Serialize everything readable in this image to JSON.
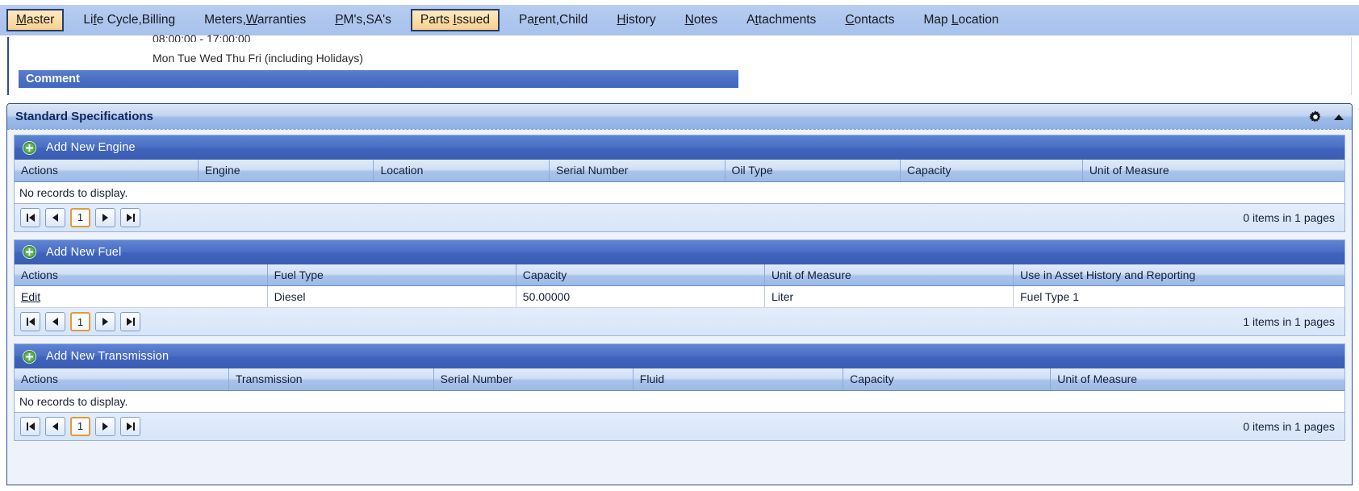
{
  "tabs": [
    {
      "label": "Master",
      "accel": "M",
      "selected": true
    },
    {
      "label": "Life Cycle,Billing",
      "accel": "f",
      "selected": false
    },
    {
      "label": "Meters,Warranties",
      "accel": "W",
      "selected": false
    },
    {
      "label": "PM's,SA's",
      "accel": "P",
      "selected": false
    },
    {
      "label": "Parts Issued",
      "accel": "I",
      "selected": true
    },
    {
      "label": "Parent,Child",
      "accel": "r",
      "selected": false
    },
    {
      "label": "History",
      "accel": "H",
      "selected": false
    },
    {
      "label": "Notes",
      "accel": "N",
      "selected": false
    },
    {
      "label": "Attachments",
      "accel": "t",
      "selected": false
    },
    {
      "label": "Contacts",
      "accel": "C",
      "selected": false
    },
    {
      "label": "Map Location",
      "accel": "L",
      "selected": false
    }
  ],
  "schedule": {
    "hours": "08:00:00 - 17:00:00",
    "days": "Mon Tue Wed Thu Fri (including Holidays)",
    "comment_label": "Comment"
  },
  "spec_panel": {
    "title": "Standard Specifications",
    "gear_icon": "gear-icon",
    "collapse_icon": "caret-up-icon"
  },
  "grids": [
    {
      "key": "engine",
      "add_label": "Add New Engine",
      "add_icon": "plus-circle-icon",
      "columns": [
        "Actions",
        "Engine",
        "Location",
        "Serial Number",
        "Oil Type",
        "Capacity",
        "Unit of Measure"
      ],
      "widths": [
        "13.8%",
        "13.2%",
        "13.2%",
        "13.2%",
        "13.2%",
        "13.7%",
        "19.7%"
      ],
      "rows": [],
      "empty_text": "No records to display.",
      "pager": {
        "first": "first-page",
        "prev": "previous-page",
        "page": "1",
        "next": "next-page",
        "last": "last-page",
        "count": "0 items in 1 pages"
      }
    },
    {
      "key": "fuel",
      "add_label": "Add New Fuel",
      "add_icon": "plus-circle-icon",
      "columns": [
        "Actions",
        "Fuel Type",
        "Capacity",
        "Unit of Measure",
        "Use in Asset History and Reporting"
      ],
      "widths": [
        "19%",
        "18.7%",
        "18.7%",
        "18.7%",
        "24.9%"
      ],
      "rows": [
        {
          "action": "Edit",
          "cells": [
            "Diesel",
            "50.00000",
            "Liter",
            "Fuel Type 1"
          ]
        }
      ],
      "empty_text": "",
      "pager": {
        "first": "first-page",
        "prev": "previous-page",
        "page": "1",
        "next": "next-page",
        "last": "last-page",
        "count": "1 items in 1 pages"
      }
    },
    {
      "key": "transmission",
      "add_label": "Add New Transmission",
      "add_icon": "plus-circle-icon",
      "columns": [
        "Actions",
        "Transmission",
        "Serial Number",
        "Fluid",
        "Capacity",
        "Unit of Measure"
      ],
      "widths": [
        "16.1%",
        "15.4%",
        "15%",
        "15.8%",
        "15.6%",
        "22.1%"
      ],
      "rows": [],
      "empty_text": "No records to display.",
      "pager": {
        "first": "first-page",
        "prev": "previous-page",
        "page": "1",
        "next": "next-page",
        "last": "last-page",
        "count": "0 items in 1 pages"
      }
    }
  ]
}
